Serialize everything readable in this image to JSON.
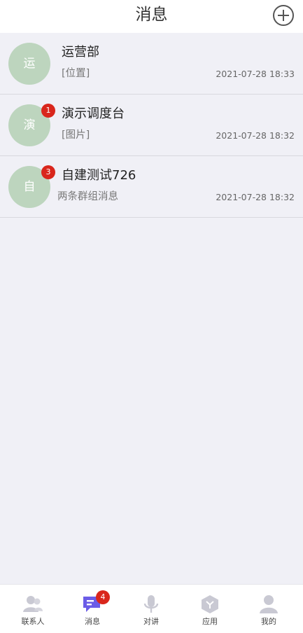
{
  "header": {
    "title": "消息",
    "add_icon": "plus-circle-icon"
  },
  "conversations": [
    {
      "avatar_char": "运",
      "name": "运营部",
      "preview": "[位置]",
      "time": "2021-07-28 18:33",
      "unread": null
    },
    {
      "avatar_char": "演",
      "name": "演示调度台",
      "preview": "[图片]",
      "time": "2021-07-28 18:32",
      "unread": "1"
    },
    {
      "avatar_char": "自",
      "name": "自建测试726",
      "preview": "两条群组消息",
      "time": "2021-07-28 18:32",
      "unread": "3"
    }
  ],
  "tabbar": {
    "active": "消息",
    "tabs": [
      {
        "label": "联系人",
        "icon": "contacts-icon",
        "badge": null
      },
      {
        "label": "消息",
        "icon": "message-icon",
        "badge": "4"
      },
      {
        "label": "对讲",
        "icon": "microphone-icon",
        "badge": null
      },
      {
        "label": "应用",
        "icon": "apps-cube-icon",
        "badge": null
      },
      {
        "label": "我的",
        "icon": "profile-icon",
        "badge": null
      }
    ]
  },
  "colors": {
    "avatar_bg": "#bdd5be",
    "badge": "#d9261c",
    "active_tab": "#6b5ce7",
    "inactive_tab": "#c9c9d3",
    "list_bg": "#f0f0f6"
  }
}
